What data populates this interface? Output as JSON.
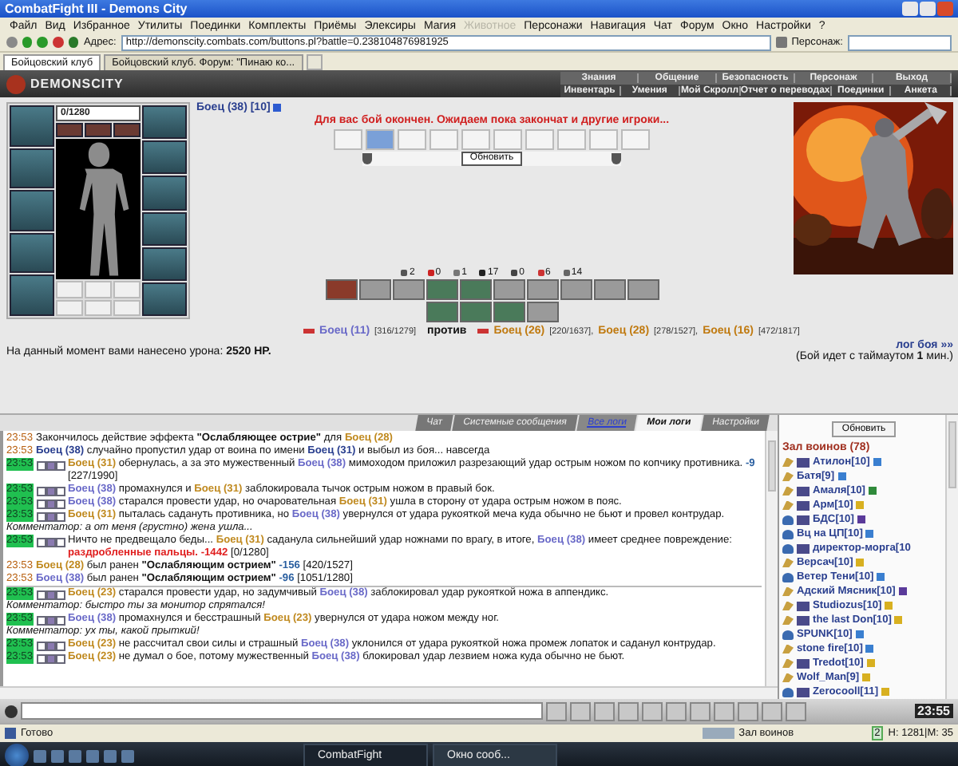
{
  "window": {
    "title": "CombatFight III - Demons City"
  },
  "menu": [
    {
      "label": "Файл",
      "disabled": false
    },
    {
      "label": "Вид",
      "disabled": false
    },
    {
      "label": "Избранное",
      "disabled": false
    },
    {
      "label": "Утилиты",
      "disabled": false
    },
    {
      "label": "Поединки",
      "disabled": false
    },
    {
      "label": "Комплекты",
      "disabled": false
    },
    {
      "label": "Приёмы",
      "disabled": false
    },
    {
      "label": "Элексиры",
      "disabled": false
    },
    {
      "label": "Магия",
      "disabled": false
    },
    {
      "label": "Животное",
      "disabled": true
    },
    {
      "label": "Персонажи",
      "disabled": false
    },
    {
      "label": "Навигация",
      "disabled": false
    },
    {
      "label": "Чат",
      "disabled": false
    },
    {
      "label": "Форум",
      "disabled": false
    },
    {
      "label": "Окно",
      "disabled": false
    },
    {
      "label": "Настройки",
      "disabled": false
    },
    {
      "label": "?",
      "disabled": false
    }
  ],
  "address": {
    "label": "Адрес:",
    "value": "http://demonscity.combats.com/buttons.pl?battle=0.238104876981925",
    "character_label": "Персонаж:"
  },
  "tabs": [
    {
      "label": "Бойцовский клуб",
      "selected": true
    },
    {
      "label": "Бойцовский клуб. Форум: \"Пинаю ко...",
      "selected": false
    }
  ],
  "site": {
    "logo": "DEMONSCITY",
    "nav_top": [
      "Знания",
      "Общение",
      "Безопасность",
      "Персонаж",
      "Выход"
    ],
    "nav_bottom": [
      "Инвентарь",
      "Умения",
      "Мой Скролл",
      "Отчет о переводах",
      "Поединки",
      "Анкета"
    ]
  },
  "battle": {
    "player": {
      "name": "Боец (38)",
      "level": "[10]"
    },
    "hp": {
      "text": "0/1280",
      "level": 0
    },
    "message": "Для вас бой окончен. Ожидаем пока закончат и другие игроки...",
    "slots": [
      {
        "filled": false
      },
      {
        "filled": true
      },
      {
        "filled": false
      },
      {
        "filled": false
      },
      {
        "filled": false
      },
      {
        "filled": false
      },
      {
        "filled": false
      },
      {
        "filled": false
      },
      {
        "filled": false
      },
      {
        "filled": false
      }
    ],
    "refresh": "Обновить",
    "stats": [
      {
        "kind": "hit",
        "value": "2"
      },
      {
        "kind": "crit",
        "value": "0"
      },
      {
        "kind": "counter",
        "value": "1"
      },
      {
        "kind": "block",
        "value": "17"
      },
      {
        "kind": "parry",
        "value": "0"
      },
      {
        "kind": "heart",
        "value": "6"
      },
      {
        "kind": "spirit",
        "value": "14"
      }
    ],
    "team1": [
      {
        "name": "Боец (11)",
        "hp": "[316/1279]"
      }
    ],
    "versus": "против",
    "team2": [
      {
        "name": "Боец (26)",
        "hp": "[220/1637],"
      },
      {
        "name": "Боец (28)",
        "hp": "[278/1527],"
      },
      {
        "name": "Боец (16)",
        "hp": "[472/1817]"
      }
    ],
    "damage": "На данный момент вами нанесено урона: **2520 HP.**",
    "log_link": "лог боя »»",
    "timeout": "(Бой идет с таймаутом **1** мин.)"
  },
  "log_tabs": [
    {
      "label": "Чат",
      "selected": false,
      "kind": "plain"
    },
    {
      "label": "Системные сообщения",
      "selected": false,
      "kind": "plain"
    },
    {
      "label": "Все логи",
      "selected": false,
      "kind": "link"
    },
    {
      "label": "Мои логи",
      "selected": true,
      "kind": "plain"
    },
    {
      "label": "Настройки",
      "selected": false,
      "kind": "plain"
    }
  ],
  "log": [
    {
      "kind": "event",
      "time": "23:53",
      "fresh": false,
      "new_turn": false,
      "parts": [
        {
          "kind": "text",
          "text": "Закончилось действие эффекта "
        },
        {
          "kind": "effect",
          "text": "\"Ослабляющее острие\""
        },
        {
          "kind": "text",
          "text": " для "
        },
        {
          "kind": "enemy",
          "text": "Боец (28)"
        }
      ]
    },
    {
      "kind": "event",
      "time": "23:53",
      "fresh": false,
      "new_turn": false,
      "parts": [
        {
          "kind": "hero",
          "text": "Боец (38)"
        },
        {
          "kind": "text",
          "text": " случайно пропустил удар от воина по имени "
        },
        {
          "kind": "hero",
          "text": "Боец (31)"
        },
        {
          "kind": "text",
          "text": " и выбыл из боя... навсегда"
        }
      ]
    },
    {
      "kind": "hit",
      "time": "23:53",
      "fresh": true,
      "new_turn": false,
      "parts": [
        {
          "kind": "enemy",
          "text": "Боец (31)"
        },
        {
          "kind": "text",
          "text": " обернулась, а за это мужественный "
        },
        {
          "kind": "ally",
          "text": "Боец (38)"
        },
        {
          "kind": "text",
          "text": " мимоходом приложил разрезающий удар острым ножом по копчику противника. "
        },
        {
          "kind": "dmg",
          "text": "-9"
        },
        {
          "kind": "text",
          "text": " [227/1990]"
        }
      ]
    },
    {
      "kind": "hit",
      "time": "23:53",
      "fresh": true,
      "new_turn": false,
      "parts": [
        {
          "kind": "ally",
          "text": "Боец (38)"
        },
        {
          "kind": "text",
          "text": " промахнулся и "
        },
        {
          "kind": "enemy",
          "text": "Боец (31)"
        },
        {
          "kind": "text",
          "text": " заблокировала тычок острым ножом в правый бок."
        }
      ]
    },
    {
      "kind": "hit",
      "time": "23:53",
      "fresh": true,
      "new_turn": false,
      "parts": [
        {
          "kind": "ally",
          "text": "Боец (38)"
        },
        {
          "kind": "text",
          "text": " старался провести удар, но очаровательная "
        },
        {
          "kind": "enemy",
          "text": "Боец (31)"
        },
        {
          "kind": "text",
          "text": " ушла в сторону от удара острым ножом в пояс."
        }
      ]
    },
    {
      "kind": "hit",
      "time": "23:53",
      "fresh": true,
      "new_turn": false,
      "parts": [
        {
          "kind": "enemy",
          "text": "Боец (31)"
        },
        {
          "kind": "text",
          "text": " пыталась садануть противника, но "
        },
        {
          "kind": "ally",
          "text": "Боец (38)"
        },
        {
          "kind": "text",
          "text": " увернулся от удара рукояткой меча куда обычно не бьют и провел контрудар."
        }
      ]
    },
    {
      "kind": "comment",
      "parts": [
        {
          "kind": "text",
          "text": "Комментатор: а от меня (грустно) жена ушла..."
        }
      ]
    },
    {
      "kind": "hit",
      "time": "23:53",
      "fresh": true,
      "new_turn": false,
      "parts": [
        {
          "kind": "text",
          "text": "Ничто не предвещало беды... "
        },
        {
          "kind": "enemy",
          "text": "Боец (31)"
        },
        {
          "kind": "text",
          "text": " саданула сильнейший удар ножнами по врагу, в итоге, "
        },
        {
          "kind": "ally",
          "text": "Боец (38)"
        },
        {
          "kind": "text",
          "text": " имеет среднее повреждение: "
        },
        {
          "kind": "crit",
          "text": "раздробленные пальцы. -1442"
        },
        {
          "kind": "text",
          "text": " [0/1280]"
        }
      ]
    },
    {
      "kind": "event",
      "time": "23:53",
      "fresh": false,
      "new_turn": false,
      "parts": [
        {
          "kind": "enemy",
          "text": "Боец (28)"
        },
        {
          "kind": "text",
          "text": " был ранен "
        },
        {
          "kind": "effect",
          "text": "\"Ослабляющим острием\" "
        },
        {
          "kind": "dmg",
          "text": "-156"
        },
        {
          "kind": "text",
          "text": " [420/1527]"
        }
      ]
    },
    {
      "kind": "event",
      "time": "23:53",
      "fresh": false,
      "new_turn": false,
      "parts": [
        {
          "kind": "ally",
          "text": "Боец (38)"
        },
        {
          "kind": "text",
          "text": " был ранен "
        },
        {
          "kind": "effect",
          "text": "\"Ослабляющим острием\" "
        },
        {
          "kind": "dmg",
          "text": "-96"
        },
        {
          "kind": "text",
          "text": " [1051/1280]"
        }
      ]
    },
    {
      "kind": "hit",
      "time": "23:53",
      "fresh": true,
      "new_turn": true,
      "parts": [
        {
          "kind": "enemy",
          "text": "Боец (23)"
        },
        {
          "kind": "text",
          "text": " старался провести удар, но задумчивый "
        },
        {
          "kind": "ally",
          "text": "Боец (38)"
        },
        {
          "kind": "text",
          "text": " заблокировал удар рукояткой ножа в аппендикс."
        }
      ]
    },
    {
      "kind": "comment",
      "parts": [
        {
          "kind": "text",
          "text": "Комментатор: быстро ты за монитор спрятался!"
        }
      ]
    },
    {
      "kind": "hit",
      "time": "23:53",
      "fresh": true,
      "new_turn": false,
      "parts": [
        {
          "kind": "ally",
          "text": "Боец (38)"
        },
        {
          "kind": "text",
          "text": " промахнулся и бесстрашный "
        },
        {
          "kind": "enemy",
          "text": "Боец (23)"
        },
        {
          "kind": "text",
          "text": " увернулся от удара ножом между ног."
        }
      ]
    },
    {
      "kind": "comment",
      "parts": [
        {
          "kind": "text",
          "text": "Комментатор: ух ты, какой прыткий!"
        }
      ]
    },
    {
      "kind": "hit",
      "time": "23:53",
      "fresh": true,
      "new_turn": false,
      "parts": [
        {
          "kind": "enemy",
          "text": "Боец (23)"
        },
        {
          "kind": "text",
          "text": " не рассчитал свои силы и страшный "
        },
        {
          "kind": "ally",
          "text": "Боец (38)"
        },
        {
          "kind": "text",
          "text": " уклонился от удара рукояткой ножа промеж лопаток и саданул контрудар."
        }
      ]
    },
    {
      "kind": "hit",
      "time": "23:53",
      "fresh": true,
      "new_turn": false,
      "parts": [
        {
          "kind": "enemy",
          "text": "Боец (23)"
        },
        {
          "kind": "text",
          "text": " не думал о бое, потому мужественный "
        },
        {
          "kind": "ally",
          "text": "Боец (38)"
        },
        {
          "kind": "text",
          "text": " блокировал удар лезвием ножа куда обычно не бьют."
        }
      ]
    }
  ],
  "room": {
    "refresh": "Обновить",
    "title": "Зал воинов (78)",
    "players": [
      {
        "name": "Атилон[10]",
        "kind": "warrior",
        "emblem": true,
        "color": "#3a7fd0"
      },
      {
        "name": "Батя[9]",
        "kind": "warrior",
        "emblem": false,
        "color": "#3a7fd0"
      },
      {
        "name": "Амаля[10]",
        "kind": "warrior",
        "emblem": true,
        "color": "#2f8a3a"
      },
      {
        "name": "Арм[10]",
        "kind": "warrior",
        "emblem": true,
        "color": "#d8b020"
      },
      {
        "name": "БДС[10]",
        "kind": "mage",
        "emblem": true,
        "color": "#5a3a9a"
      },
      {
        "name": "Вц на ЦП[10]",
        "kind": "mage",
        "emblem": false,
        "color": "#3a7fd0"
      },
      {
        "name": "директор-морга[10",
        "kind": "mage",
        "emblem": true
      },
      {
        "name": "Версач[10]",
        "kind": "warrior",
        "emblem": false,
        "color": "#d8b020"
      },
      {
        "name": "Ветер Тени[10]",
        "kind": "mage",
        "emblem": false,
        "color": "#3a7fd0"
      },
      {
        "name": "Адский Мясник[10]",
        "kind": "warrior",
        "emblem": false,
        "color": "#5a3a9a"
      },
      {
        "name": "Studiozus[10]",
        "kind": "warrior",
        "emblem": true,
        "color": "#d8b020"
      },
      {
        "name": "the last Don[10]",
        "kind": "warrior",
        "emblem": true,
        "color": "#d8b020"
      },
      {
        "name": "SPUNK[10]",
        "kind": "mage",
        "emblem": false,
        "color": "#3a7fd0"
      },
      {
        "name": "stone fire[10]",
        "kind": "warrior",
        "emblem": false,
        "color": "#3a7fd0"
      },
      {
        "name": "Tredot[10]",
        "kind": "warrior",
        "emblem": true,
        "color": "#d8b020"
      },
      {
        "name": "Wolf_Man[9]",
        "kind": "warrior",
        "emblem": false,
        "color": "#d8b020"
      },
      {
        "name": "Zerocooll[11]",
        "kind": "mage",
        "emblem": true,
        "color": "#d8b020"
      }
    ]
  },
  "clock": "23:55",
  "status": {
    "text": "Готово",
    "zone": "Зал воинов",
    "count": "2",
    "stats": "H: 1281|M: 35"
  },
  "taskbar": [
    {
      "label": "CombatFight",
      "selected": true
    },
    {
      "label": "Окно сооб...",
      "selected": false
    }
  ]
}
